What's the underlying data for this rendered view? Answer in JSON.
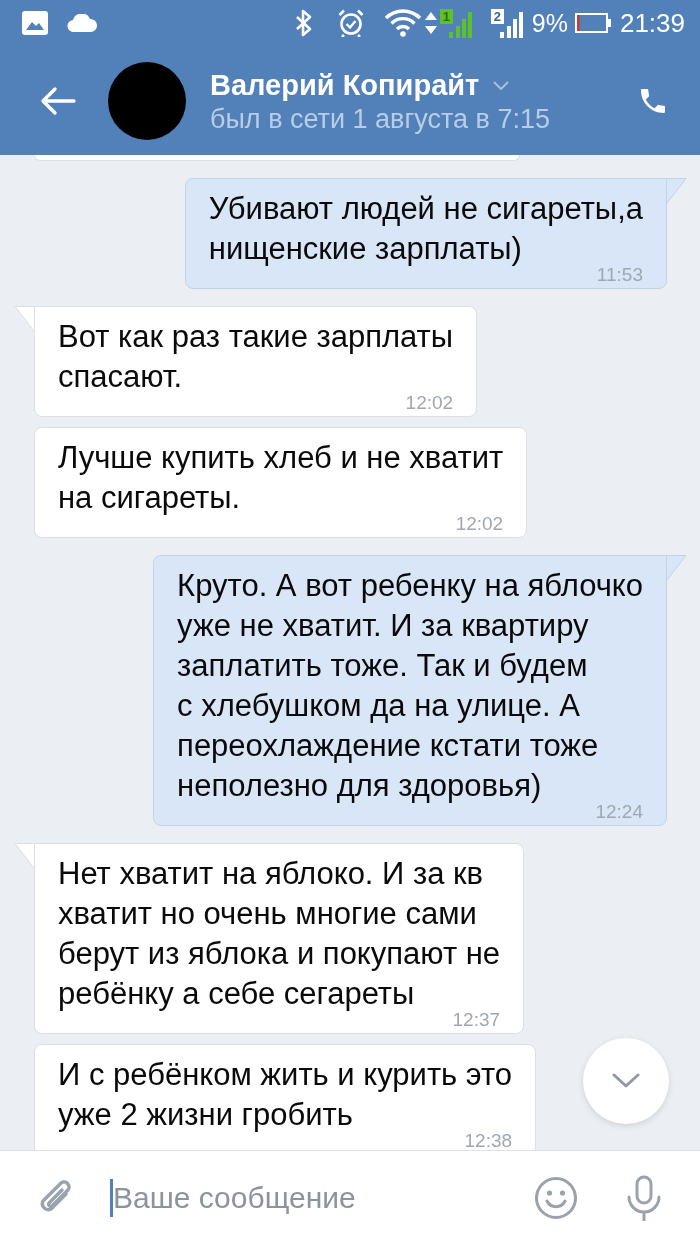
{
  "status_bar": {
    "sim_signals": [
      {
        "label": "1",
        "active": true
      },
      {
        "label": "2",
        "active": false
      }
    ],
    "battery": "9%",
    "time": "21:39"
  },
  "header": {
    "name": "Валерий Копирайт",
    "status": "был в сети 1 августа в 7:15"
  },
  "messages": [
    {
      "kind": "outgoing",
      "tail": true,
      "text": "Убивают людей не сигареты,а\nнищенские зарплаты)",
      "time": "11:53"
    },
    {
      "kind": "incoming",
      "tail": true,
      "text": "Вот как раз такие зарплаты\nспасают.",
      "time": "12:02"
    },
    {
      "kind": "incoming",
      "tail": false,
      "text": "Лучше купить хлеб и не хватит\nна сигареты.",
      "time": "12:02"
    },
    {
      "kind": "outgoing",
      "tail": true,
      "text": "Круто. А вот ребенку на яблочко\nуже не хватит. И за квартиру\nзаплатить тоже. Так и будем\nс хлебушком да на улице. А\nпереохлаждение кстати тоже\nнеполезно для здоровья)",
      "time": "12:24"
    },
    {
      "kind": "incoming",
      "tail": true,
      "text": "Нет хватит на яблоко. И за кв\nхватит но очень многие сами\nберут из яблока и покупают не\nребёнку а себе сегареты",
      "time": "12:37"
    },
    {
      "kind": "incoming",
      "tail": false,
      "text": "И с ребёнком жить и курить это\nуже 2 жизни гробить",
      "time": "12:38"
    }
  ],
  "composer": {
    "placeholder": "Ваше сообщение"
  }
}
